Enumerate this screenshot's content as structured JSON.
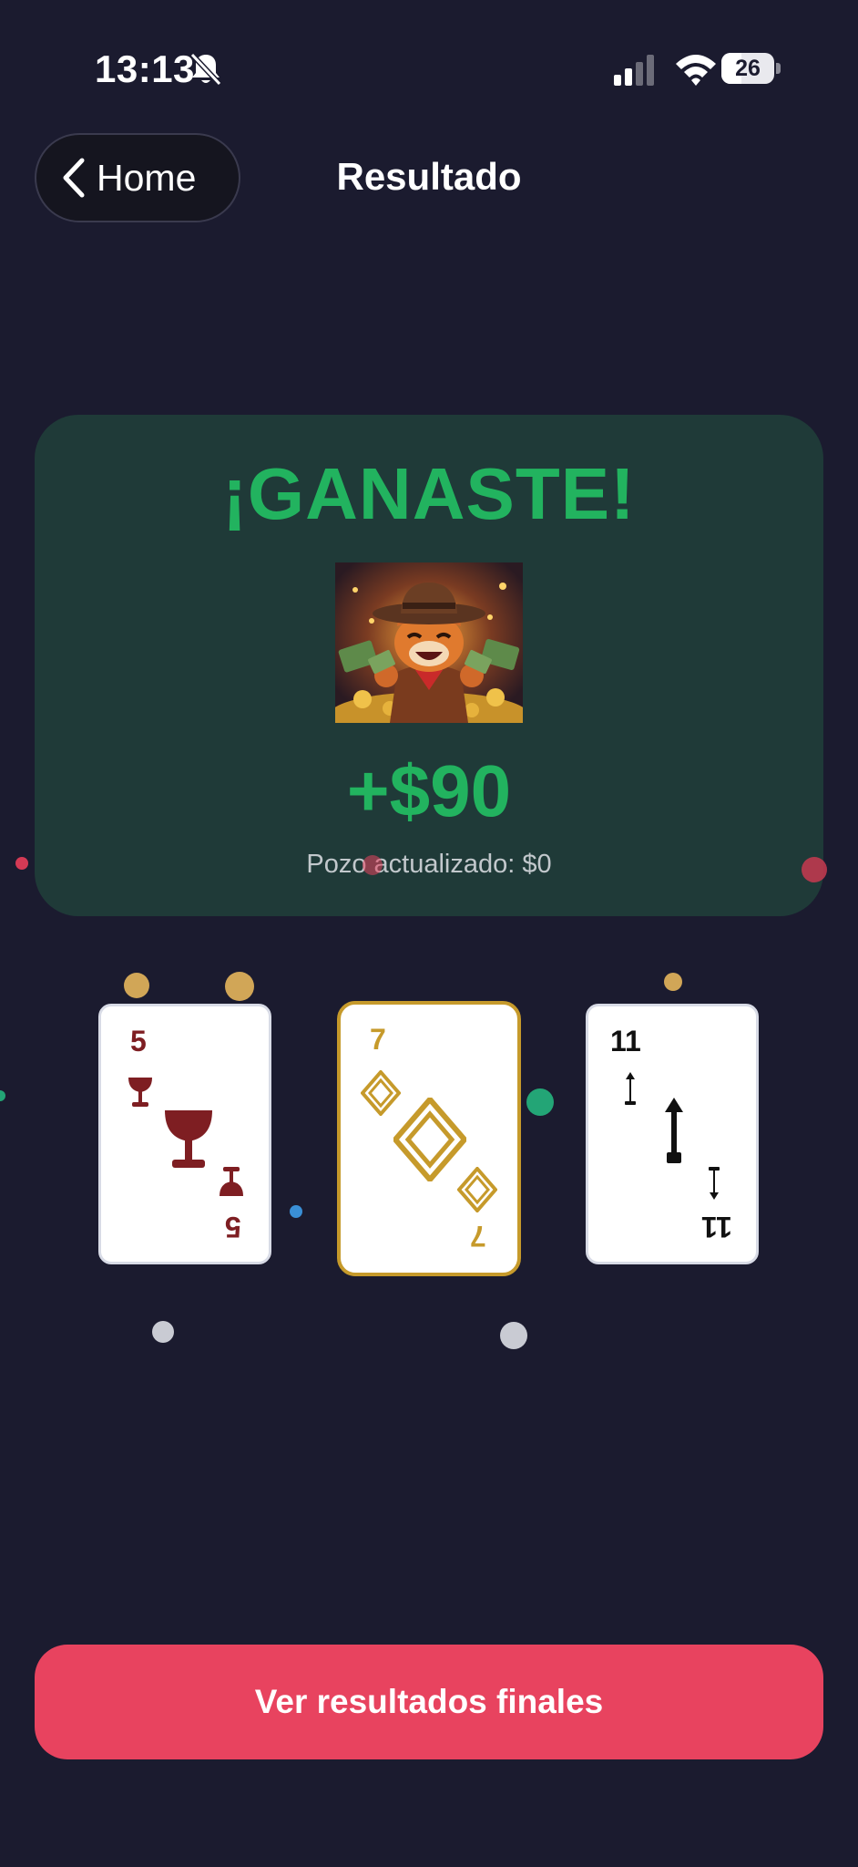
{
  "status_bar": {
    "time": "13:13",
    "battery": "26",
    "icons": [
      "bell-slash-icon",
      "signal-icon",
      "wifi-icon",
      "battery-icon"
    ]
  },
  "nav": {
    "back_label": "Home",
    "title": "Resultado"
  },
  "result": {
    "heading": "¡GANASTE!",
    "amount": "+$90",
    "pot_text": "Pozo actualizado: $0"
  },
  "cards": [
    {
      "rank": "5",
      "suit": "cups-icon",
      "color": "#7e1e22",
      "selected": false
    },
    {
      "rank": "7",
      "suit": "diamonds-icon",
      "color": "#c69a2b",
      "selected": true
    },
    {
      "rank": "11",
      "suit": "swords-icon",
      "color": "#111111",
      "selected": false
    }
  ],
  "cta": {
    "label": "Ver resultados finales"
  },
  "colors": {
    "background": "#1b1b2f",
    "card_bg": "#1f3a38",
    "accent_green": "#22b35f",
    "cta": "#e8435f",
    "gold": "#c69a2b"
  }
}
